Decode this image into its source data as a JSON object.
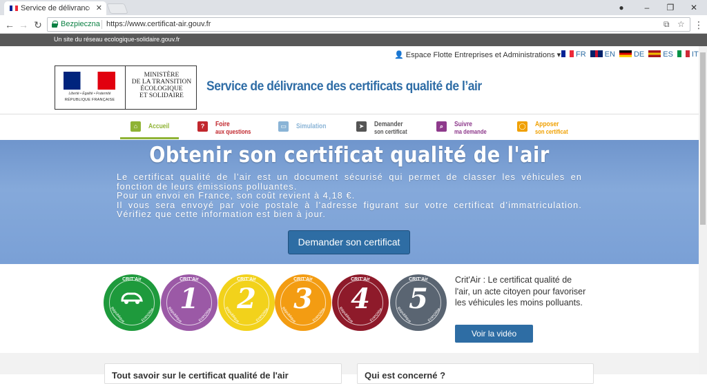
{
  "browser": {
    "tab_title": "Service de délivrance des",
    "tab_close": "✕",
    "controls": {
      "profile": "●",
      "minimize": "–",
      "restore": "❐",
      "close": "✕"
    },
    "nav": {
      "back": "←",
      "forward": "→",
      "reload": "↻"
    },
    "security_label": "Bezpieczna",
    "url": "https://www.certificat-air.gouv.fr",
    "translate_icon": "⧉",
    "bookmark_icon": "☆",
    "menu_icon": "⋮"
  },
  "gov_bar": {
    "text": "Un site du réseau ecologique-solidaire.gouv.fr"
  },
  "header": {
    "espace": "Espace Flotte Entreprises et Administrations",
    "languages": [
      {
        "code": "FR",
        "colors": [
          "#002395",
          "#ffffff",
          "#ed2939"
        ]
      },
      {
        "code": "EN",
        "colors": [
          "#012169",
          "#ffffff",
          "#c8102e"
        ]
      },
      {
        "code": "DE",
        "colors": [
          "#000000",
          "#dd0000",
          "#ffce00"
        ]
      },
      {
        "code": "ES",
        "colors": [
          "#aa151b",
          "#f1bf00",
          "#aa151b"
        ]
      },
      {
        "code": "IT",
        "colors": [
          "#009246",
          "#ffffff",
          "#ce2b37"
        ]
      }
    ],
    "logo": {
      "devise": "Liberté • Égalité • Fraternité",
      "republique": "RÉPUBLIQUE FRANÇAISE",
      "ministere_lines": [
        "MINISTÈRE",
        "DE LA TRANSITION",
        "ÉCOLOGIQUE",
        "ET SOLIDAIRE"
      ]
    },
    "title": "Service de délivrance des certificats qualité de l’air"
  },
  "nav": [
    {
      "line1": "Accueil",
      "line2": "",
      "color": "#8fb335",
      "icon": "⌂"
    },
    {
      "line1": "Foire",
      "line2": "aux questions",
      "color": "#c1272d",
      "icon": "?"
    },
    {
      "line1": "Simulation",
      "line2": "",
      "color": "#8ab4d6",
      "icon": "▭"
    },
    {
      "line1": "Demander",
      "line2": "son certificat",
      "color": "#555555",
      "icon": "➤"
    },
    {
      "line1": "Suivre",
      "line2": "ma demande",
      "color": "#8e3a8c",
      "icon": "⌕"
    },
    {
      "line1": "Apposer",
      "line2": "son certificat",
      "color": "#f0a000",
      "icon": "◯"
    }
  ],
  "hero": {
    "title": "Obtenir son certificat qualité de l'air",
    "paragraphs": [
      "Le certificat qualité de l’air est un document sécurisé qui permet de classer les véhicules en fonction de leurs émissions polluantes.",
      "Pour un envoi en France, son coût revient à 4,18 €.",
      "Il vous sera envoyé par voie postale à l’adresse figurant sur votre certificat d’immatriculation. Vérifiez que cette information est bien à jour."
    ],
    "button": "Demander son certificat"
  },
  "critair": {
    "badges": [
      {
        "label": "CRIT'Air",
        "num": "",
        "color": "#1e9a3c",
        "left_text": "République",
        "right_text": "Française"
      },
      {
        "label": "CRIT'Air",
        "num": "1",
        "color": "#9b59a6",
        "left_text": "République",
        "right_text": "Française"
      },
      {
        "label": "CRIT'Air",
        "num": "2",
        "color": "#f2d21b",
        "left_text": "République",
        "right_text": "Française"
      },
      {
        "label": "CRIT'Air",
        "num": "3",
        "color": "#f39c12",
        "left_text": "République",
        "right_text": "Française"
      },
      {
        "label": "CRIT'Air",
        "num": "4",
        "color": "#8e1a2a",
        "left_text": "République",
        "right_text": "Française"
      },
      {
        "label": "CRIT'Air",
        "num": "5",
        "color": "#5a6572",
        "left_text": "République",
        "right_text": "Française"
      }
    ],
    "text": "Crit'Air : Le certificat qualité de l'air, un acte citoyen pour favoriser les véhicules les moins polluants.",
    "video_button": "Voir la vidéo"
  },
  "cards": [
    {
      "title": "Tout savoir sur le certificat qualité de l'air"
    },
    {
      "title": "Qui est concerné ?"
    }
  ]
}
